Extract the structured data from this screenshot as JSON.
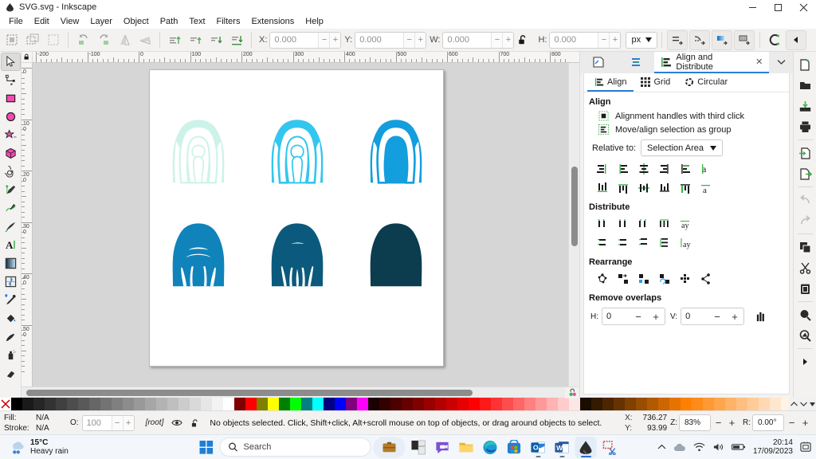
{
  "window": {
    "title": "SVG.svg - Inkscape",
    "app_icon": "inkscape-logo-icon",
    "controls": {
      "minimize": "–",
      "maximize": "☐",
      "close": "✕"
    }
  },
  "menubar": {
    "items": [
      {
        "label": "File"
      },
      {
        "label": "Edit"
      },
      {
        "label": "View"
      },
      {
        "label": "Layer"
      },
      {
        "label": "Object"
      },
      {
        "label": "Path"
      },
      {
        "label": "Text"
      },
      {
        "label": "Filters"
      },
      {
        "label": "Extensions"
      },
      {
        "label": "Help"
      }
    ]
  },
  "tool_options_bar": {
    "select_buttons": [
      {
        "name": "select-all-icon"
      },
      {
        "name": "select-all-in-layers-icon"
      },
      {
        "name": "deselect-icon"
      }
    ],
    "transform_buttons": [
      {
        "name": "rotate-ccw-icon"
      },
      {
        "name": "rotate-cw-icon"
      },
      {
        "name": "flip-horizontal-icon"
      },
      {
        "name": "flip-vertical-icon"
      }
    ],
    "zorder_buttons": [
      {
        "name": "raise-to-top-icon"
      },
      {
        "name": "raise-icon"
      },
      {
        "name": "lower-icon"
      },
      {
        "name": "lower-to-bottom-icon"
      }
    ],
    "fields": [
      {
        "label": "X:",
        "value": "0.000",
        "name": "x-field"
      },
      {
        "label": "Y:",
        "value": "0.000",
        "name": "y-field"
      },
      {
        "label": "W:",
        "value": "0.000",
        "name": "w-field"
      },
      {
        "label": "H:",
        "value": "0.000",
        "name": "h-field"
      }
    ],
    "lock_icon": "lock-open-icon",
    "units": "px",
    "affect_buttons": [
      {
        "name": "affect-stroke-width-icon"
      },
      {
        "name": "affect-rounded-corners-icon"
      },
      {
        "name": "affect-gradients-icon"
      },
      {
        "name": "affect-patterns-icon"
      }
    ],
    "snap_icon": "snap-toggle-icon",
    "collapse_icon": "chevron-left-icon"
  },
  "toolbox": {
    "tools": [
      {
        "name": "selector-tool",
        "active": true
      },
      {
        "name": "node-tool",
        "active": false
      },
      {
        "name": "rectangle-tool",
        "active": false
      },
      {
        "name": "ellipse-tool",
        "active": false
      },
      {
        "name": "star-tool",
        "active": false
      },
      {
        "name": "box3d-tool",
        "active": false
      },
      {
        "name": "spiral-tool",
        "active": false
      },
      {
        "name": "pencil-tool",
        "active": false
      },
      {
        "name": "bezier-tool",
        "active": false
      },
      {
        "name": "calligraphy-tool",
        "active": false
      },
      {
        "name": "text-tool",
        "active": false
      },
      {
        "name": "gradient-tool",
        "active": false
      },
      {
        "name": "mesh-tool",
        "active": false
      },
      {
        "name": "dropper-tool",
        "active": false
      },
      {
        "name": "paint-bucket-tool",
        "active": false
      },
      {
        "name": "tweak-tool",
        "active": false
      },
      {
        "name": "spray-tool",
        "active": false
      },
      {
        "name": "eraser-tool",
        "active": false
      }
    ]
  },
  "rulers": {
    "horizontal_labels": [
      "-200",
      "-100",
      "0",
      "100",
      "200",
      "300",
      "400",
      "500",
      "600",
      "700",
      "800"
    ],
    "vertical_labels": [
      "0",
      "100",
      "200",
      "300",
      "400",
      "500"
    ],
    "unit": "px"
  },
  "canvas": {
    "artwork_title": "traced shaggy dog silhouettes",
    "colors": {
      "shade1": "#cdf3e9",
      "shade2": "#33c6ef",
      "shade3": "#139ede",
      "shade4": "#1083bb",
      "shade5": "#0b5a7d",
      "shade6": "#0b3d4f"
    },
    "sprites": [
      {
        "name": "traced-dog-1",
        "color_key": "shade1"
      },
      {
        "name": "traced-dog-2",
        "color_key": "shade2"
      },
      {
        "name": "traced-dog-3",
        "color_key": "shade3"
      },
      {
        "name": "traced-dog-4",
        "color_key": "shade4"
      },
      {
        "name": "traced-dog-5",
        "color_key": "shade5"
      },
      {
        "name": "traced-dog-6",
        "color_key": "shade6"
      }
    ]
  },
  "dock": {
    "tabs": [
      {
        "name": "xml-editor-tab",
        "label": "",
        "icon": "xml-editor-icon",
        "active": false
      },
      {
        "name": "objects-tab",
        "label": "",
        "icon": "objects-layers-icon",
        "active": false
      },
      {
        "name": "align-and-distribute-tab",
        "label": "Align and Distribute",
        "icon": "align-icon",
        "active": true,
        "close": "✕"
      }
    ],
    "chevron": "chevron-down-icon",
    "sub_tabs": [
      {
        "label": "Align",
        "icon": "align-icon",
        "active": true
      },
      {
        "label": "Grid",
        "icon": "grid-icon",
        "active": false
      },
      {
        "label": "Circular",
        "icon": "circular-icon",
        "active": false
      }
    ],
    "align_section": {
      "title": "Align",
      "checkboxes": [
        {
          "label": "Alignment handles with third click",
          "icon": "alignment-handles-icon"
        },
        {
          "label": "Move/align selection as group",
          "icon": "move-as-group-icon"
        }
      ],
      "relative_to_label": "Relative to:",
      "relative_to_value": "Selection Area",
      "row1": [
        {
          "name": "align-right-edges-to-left-anchor"
        },
        {
          "name": "align-left-edges"
        },
        {
          "name": "center-on-vertical-axis"
        },
        {
          "name": "align-right-edges"
        },
        {
          "name": "align-left-edges-to-right-anchor"
        },
        {
          "name": "text-anchor-horizontal"
        }
      ],
      "row2": [
        {
          "name": "align-bottom-edges-to-top-anchor"
        },
        {
          "name": "align-top-edges"
        },
        {
          "name": "center-on-horizontal-axis"
        },
        {
          "name": "align-bottom-edges"
        },
        {
          "name": "align-top-edges-to-bottom-anchor"
        },
        {
          "name": "text-anchor-vertical"
        }
      ]
    },
    "distribute_section": {
      "title": "Distribute",
      "row1": [
        {
          "name": "distribute-left-edges-equidistant"
        },
        {
          "name": "distribute-centers-horizontally"
        },
        {
          "name": "distribute-right-edges-equidistant"
        },
        {
          "name": "distribute-horizontal-gaps"
        },
        {
          "name": "distribute-text-anchors-horizontally"
        }
      ],
      "row2": [
        {
          "name": "distribute-top-edges-equidistant"
        },
        {
          "name": "distribute-centers-vertically"
        },
        {
          "name": "distribute-bottom-edges-equidistant"
        },
        {
          "name": "distribute-vertical-gaps"
        },
        {
          "name": "distribute-text-anchors-vertically"
        }
      ]
    },
    "rearrange_section": {
      "title": "Rearrange",
      "buttons": [
        {
          "name": "graph-layout-icon"
        },
        {
          "name": "exchange-positions-selection-order-icon"
        },
        {
          "name": "exchange-positions-zorder-icon"
        },
        {
          "name": "exchange-positions-clockwise-icon"
        },
        {
          "name": "randomize-positions-icon"
        },
        {
          "name": "unclump-icon"
        }
      ]
    },
    "remove_overlaps_section": {
      "title": "Remove overlaps",
      "h_label": "H:",
      "h_value": "0",
      "v_label": "V:",
      "v_value": "0",
      "minus": "−",
      "plus": "+",
      "apply_icon": "remove-overlaps-apply-icon"
    }
  },
  "command_bar": {
    "buttons": [
      {
        "name": "new-document-icon"
      },
      {
        "name": "open-document-icon"
      },
      {
        "name": "save-document-icon"
      },
      {
        "name": "print-document-icon"
      },
      {
        "name": "import-icon"
      },
      {
        "name": "export-icon"
      },
      {
        "name": "undo-icon"
      },
      {
        "name": "redo-icon"
      },
      {
        "name": "copy-icon"
      },
      {
        "name": "cut-icon"
      },
      {
        "name": "paste-icon"
      },
      {
        "name": "zoom-selection-icon"
      },
      {
        "name": "zoom-drawing-icon"
      },
      {
        "name": "overflow-arrow-icon"
      }
    ]
  },
  "palette": {
    "remove_color_icon": "remove-color-x-icon",
    "scroll_up_icon": "chevron-up-icon",
    "scroll_down_icon": "chevron-down-icon",
    "menu_icon": "palette-menu-icon",
    "swatches": [
      "#000000",
      "#1a1a1a",
      "#262626",
      "#333333",
      "#404040",
      "#4d4d4d",
      "#595959",
      "#666666",
      "#737373",
      "#808080",
      "#8c8c8c",
      "#999999",
      "#a6a6a6",
      "#b3b3b3",
      "#bfbfbf",
      "#cccccc",
      "#d9d9d9",
      "#e6e6e6",
      "#f2f2f2",
      "#ffffff",
      "#800000",
      "#ff0000",
      "#808000",
      "#ffff00",
      "#008000",
      "#00ff00",
      "#008080",
      "#00ffff",
      "#000080",
      "#0000ff",
      "#800080",
      "#ff00ff",
      "#1a0000",
      "#330000",
      "#4d0000",
      "#660000",
      "#800000",
      "#990000",
      "#b30000",
      "#cc0000",
      "#e60000",
      "#ff0000",
      "#ff1a1a",
      "#ff3333",
      "#ff4d4d",
      "#ff6666",
      "#ff8080",
      "#ff9999",
      "#ffb3b3",
      "#ffcccc",
      "#ffe6e6",
      "#1a0d00",
      "#331a00",
      "#4d2600",
      "#663300",
      "#804000",
      "#994d00",
      "#b35900",
      "#cc6600",
      "#e67300",
      "#ff8000",
      "#ff8c1a",
      "#ff9933",
      "#ffa64d",
      "#ffb366",
      "#ffbf80",
      "#ffcc99",
      "#ffd9b3",
      "#ffe6cc",
      "#fff2e6"
    ]
  },
  "statusbar": {
    "fill_label": "Fill:",
    "fill_value": "N/A",
    "stroke_label": "Stroke:",
    "stroke_value": "N/A",
    "opacity_label": "O:",
    "opacity_value": "100",
    "layer_indicator": "[root]",
    "layer_visibility_icon": "eye-icon",
    "layer_lock_icon": "lock-open-icon",
    "message": "No objects selected. Click, Shift+click, Alt+scroll mouse on top of objects, or drag around objects to select.",
    "coord_x_label": "X:",
    "coord_x_value": "736.27",
    "coord_y_label": "Y:",
    "coord_y_value": "93.99",
    "zoom_label": "Z:",
    "zoom_value": "83%",
    "rotation_label": "R:",
    "rotation_value": "0.00°",
    "minus": "−",
    "plus": "+"
  },
  "taskbar": {
    "weather": {
      "temp": "15°C",
      "condition": "Heavy rain",
      "icon": "rain-cloud-icon"
    },
    "start_icon": "windows-start-icon",
    "search_placeholder": "Search",
    "search_icon": "search-icon",
    "apps": [
      {
        "name": "taskview-icon",
        "active": false,
        "pill": true
      },
      {
        "name": "widgets-icon",
        "active": false
      },
      {
        "name": "chat-teams-icon",
        "active": false
      },
      {
        "name": "file-explorer-icon",
        "active": false
      },
      {
        "name": "microsoft-edge-icon",
        "active": false
      },
      {
        "name": "microsoft-store-icon",
        "active": false
      },
      {
        "name": "outlook-icon",
        "active": false,
        "running": true
      },
      {
        "name": "word-icon",
        "active": false,
        "running": true
      },
      {
        "name": "inkscape-icon",
        "active": true,
        "running": true
      },
      {
        "name": "snipping-tool-icon",
        "active": false
      }
    ],
    "tray": {
      "chevron_icon": "show-hidden-icons-icon",
      "cloud_icon": "onedrive-icon",
      "wifi_icon": "wifi-icon",
      "volume_icon": "volume-icon",
      "battery_icon": "battery-icon",
      "time": "20:14",
      "date": "17/09/2023",
      "notification_icon": "notification-bell-icon"
    }
  }
}
